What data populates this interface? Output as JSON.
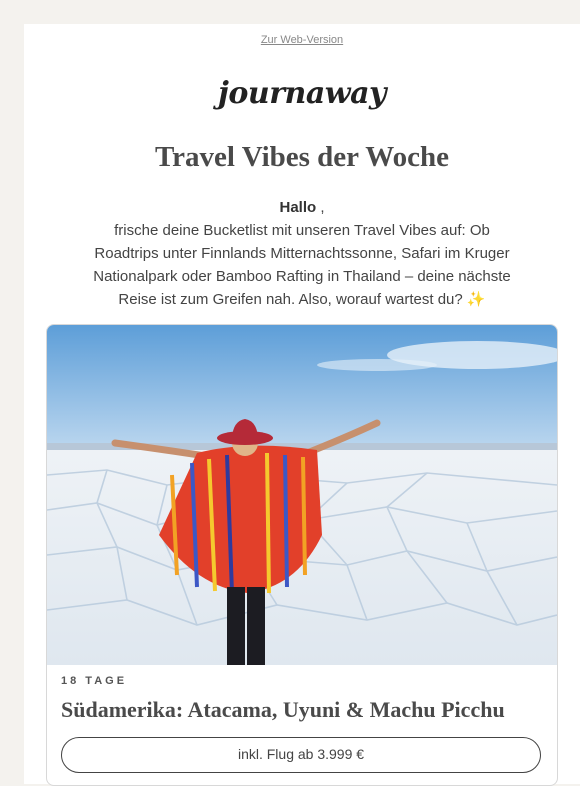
{
  "header": {
    "web_version_link": "Zur Web-Version",
    "logo_text": "journaway"
  },
  "main": {
    "title": "Travel Vibes der Woche",
    "greeting": "Hallo",
    "greeting_suffix": " ,",
    "intro_text": "frische deine Bucketlist mit unseren Travel Vibes auf: Ob Roadtrips unter Finnlands Mitternachtssonne, Safari im Kruger Nationalpark oder Bamboo Rafting in Thailand – deine nächste Reise ist zum Greifen nah. Also, worauf wartest du? ✨"
  },
  "trip_card": {
    "duration": "18 TAGE",
    "title": "Südamerika: Atacama, Uyuni & Machu Picchu",
    "price_button": "inkl. Flug ab 3.999 €"
  },
  "colors": {
    "page_background": "#f4f2ee",
    "text": "#444444",
    "poncho_red": "#e2402a",
    "hat": "#b52a38",
    "sky": "#7fb2e0"
  }
}
